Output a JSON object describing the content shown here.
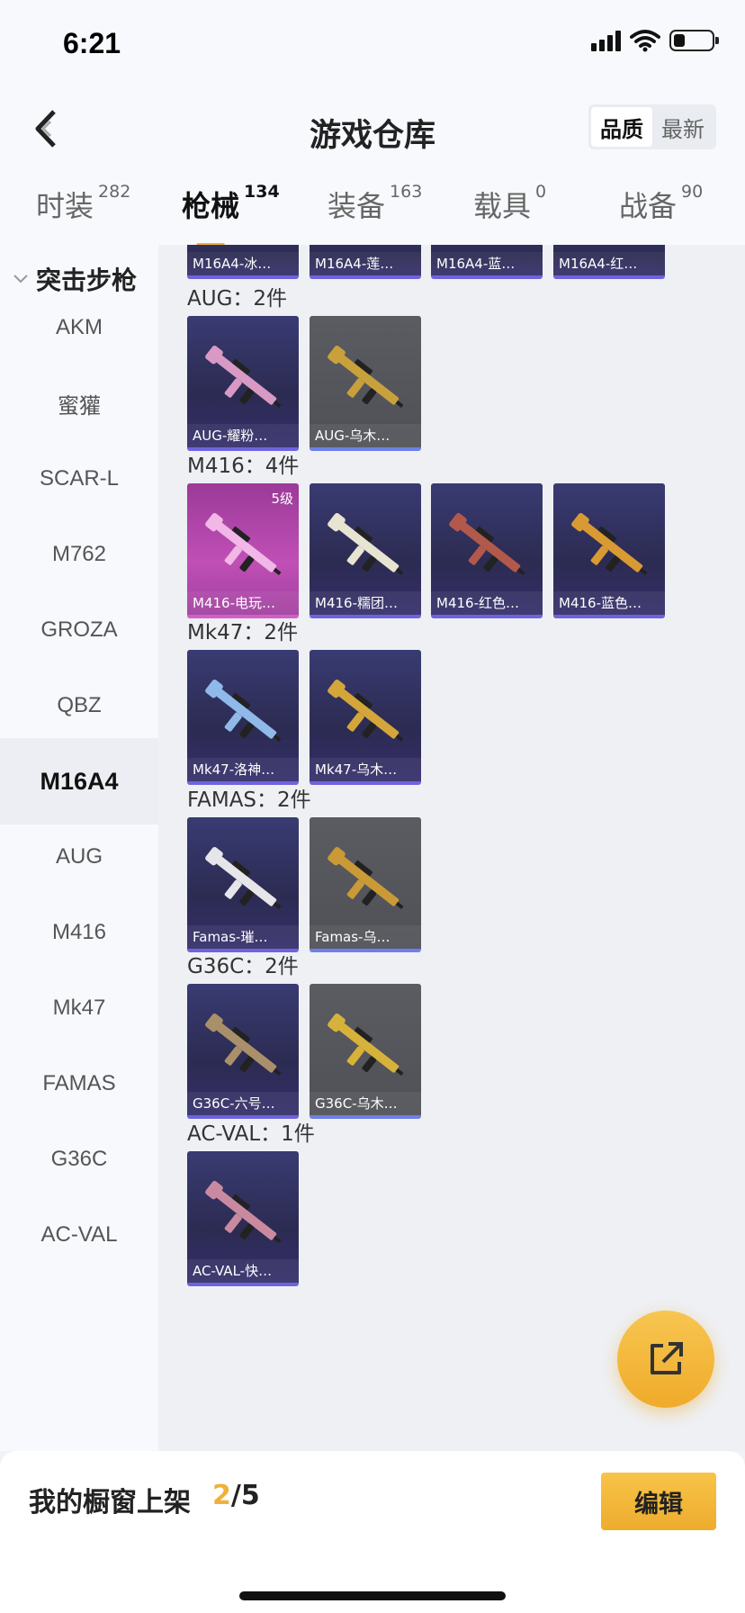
{
  "status": {
    "time": "6:21"
  },
  "nav": {
    "title": "游戏仓库",
    "sort": [
      "品质",
      "最新"
    ]
  },
  "tabs": [
    {
      "label": "时装",
      "count": "282"
    },
    {
      "label": "枪械",
      "count": "134"
    },
    {
      "label": "装备",
      "count": "163"
    },
    {
      "label": "载具",
      "count": "0"
    },
    {
      "label": "战备",
      "count": "90"
    }
  ],
  "sidebar": {
    "header": "突击步枪",
    "items": [
      "AKM",
      "蜜獾",
      "SCAR-L",
      "M762",
      "GROZA",
      "QBZ",
      "M16A4",
      "AUG",
      "M416",
      "Mk47",
      "FAMAS",
      "G36C",
      "AC-VAL"
    ],
    "selected": "M16A4"
  },
  "top_cards": [
    "M16A4-冰…",
    "M16A4-莲…",
    "M16A4-蓝…",
    "M16A4-红…"
  ],
  "sections": [
    {
      "title": "AUG：2件",
      "cards": [
        {
          "name": "AUG-耀粉…",
          "style": "purple",
          "gun": "#d89ac4"
        },
        {
          "name": "AUG-乌木…",
          "style": "gray",
          "gun": "#c9a13c"
        }
      ]
    },
    {
      "title": "M416：4件",
      "cards": [
        {
          "name": "M416-电玩…",
          "style": "pink",
          "gun": "#f1b7e6",
          "level": "5级"
        },
        {
          "name": "M416-糯团…",
          "style": "purple",
          "gun": "#e8e4d2"
        },
        {
          "name": "M416-红色…",
          "style": "purple",
          "gun": "#b2594c"
        },
        {
          "name": "M416-蓝色…",
          "style": "purple",
          "gun": "#d99a34"
        }
      ]
    },
    {
      "title": "Mk47：2件",
      "cards": [
        {
          "name": "Mk47-洛神…",
          "style": "purple",
          "gun": "#8fb9e8"
        },
        {
          "name": "Mk47-乌木…",
          "style": "purple",
          "gun": "#d4a63a"
        }
      ]
    },
    {
      "title": "FAMAS：2件",
      "cards": [
        {
          "name": "Famas-璀…",
          "style": "purple",
          "gun": "#e6e6ea"
        },
        {
          "name": "Famas-乌…",
          "style": "gray",
          "gun": "#c99a36"
        }
      ]
    },
    {
      "title": "G36C：2件",
      "cards": [
        {
          "name": "G36C-六号…",
          "style": "purple",
          "gun": "#a9906a"
        },
        {
          "name": "G36C-乌木…",
          "style": "gray",
          "gun": "#d7b23a"
        }
      ]
    },
    {
      "title": "AC-VAL：1件",
      "cards": [
        {
          "name": "AC-VAL-快…",
          "style": "purple",
          "gun": "#c98aa0"
        }
      ]
    }
  ],
  "bottom": {
    "label": "我的橱窗上架",
    "current": "2",
    "total": "/5",
    "edit": "编辑"
  },
  "colors": {
    "accent": "#f0b13a",
    "card_purple": "#2c2b52",
    "card_border": "#6e63dd"
  }
}
